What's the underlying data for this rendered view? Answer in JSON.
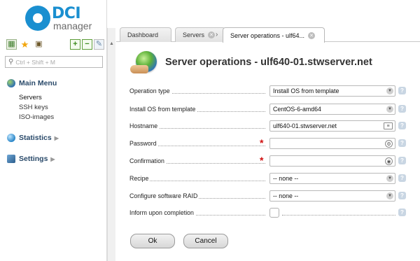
{
  "app": {
    "logo_text": "DCI",
    "logo_subtext": "manager"
  },
  "sidebar": {
    "search_placeholder": "Ctrl + Shift + M",
    "main_menu": {
      "label": "Main Menu",
      "items": [
        {
          "label": "Servers"
        },
        {
          "label": "SSH keys"
        },
        {
          "label": "ISO-images"
        }
      ]
    },
    "statistics": {
      "label": "Statistics"
    },
    "settings": {
      "label": "Settings"
    }
  },
  "tabs": [
    {
      "label": "Dashboard"
    },
    {
      "label": "Servers"
    },
    {
      "label": "Server operations - ulf64..."
    }
  ],
  "page": {
    "title": "Server operations - ulf640-01.stwserver.net"
  },
  "form": {
    "fields": [
      {
        "label": "Operation type",
        "value": "Install OS from template",
        "type": "select"
      },
      {
        "label": "Install OS from template",
        "value": "CentOS-6-amd64",
        "type": "select"
      },
      {
        "label": "Hostname",
        "value": "ulf640-01.stwserver.net",
        "type": "text"
      },
      {
        "label": "Password",
        "value": "",
        "type": "password",
        "required": true
      },
      {
        "label": "Confirmation",
        "value": "",
        "type": "password",
        "required": true
      },
      {
        "label": "Recipe",
        "value": "-- none --",
        "type": "select"
      },
      {
        "label": "Configure software RAID",
        "value": "-- none --",
        "type": "select"
      },
      {
        "label": "Inform upon completion",
        "checked": false,
        "type": "checkbox"
      }
    ],
    "ok_label": "Ok",
    "cancel_label": "Cancel"
  }
}
